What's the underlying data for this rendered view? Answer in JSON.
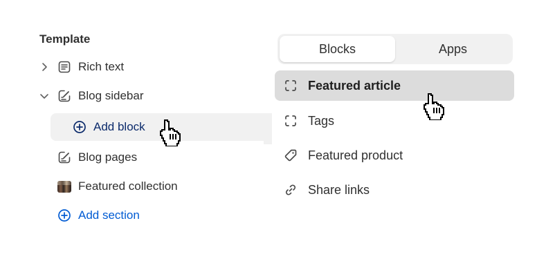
{
  "template": {
    "title": "Template",
    "items": [
      {
        "label": "Rich text",
        "icon": "text-block-icon",
        "chevron": "right"
      },
      {
        "label": "Blog sidebar",
        "icon": "edit-page-icon",
        "chevron": "down"
      },
      {
        "label": "Add block",
        "icon": "plus-circle-icon"
      },
      {
        "label": "Blog pages",
        "icon": "edit-page-icon"
      },
      {
        "label": "Featured collection",
        "icon": "collection-thumbnail"
      },
      {
        "label": "Add section",
        "icon": "plus-circle-icon"
      }
    ]
  },
  "picker": {
    "tabs": [
      {
        "label": "Blocks",
        "active": true
      },
      {
        "label": "Apps",
        "active": false
      }
    ],
    "options": [
      {
        "label": "Featured article",
        "icon": "dashed-square-icon",
        "hovered": true
      },
      {
        "label": "Tags",
        "icon": "dashed-square-icon"
      },
      {
        "label": "Featured product",
        "icon": "tag-icon"
      },
      {
        "label": "Share links",
        "icon": "link-icon"
      }
    ]
  },
  "colors": {
    "accent_blue": "#005bd3",
    "hover_bg": "#dcdcdc",
    "panel_bg": "#f1f1f1",
    "text": "#303030"
  }
}
